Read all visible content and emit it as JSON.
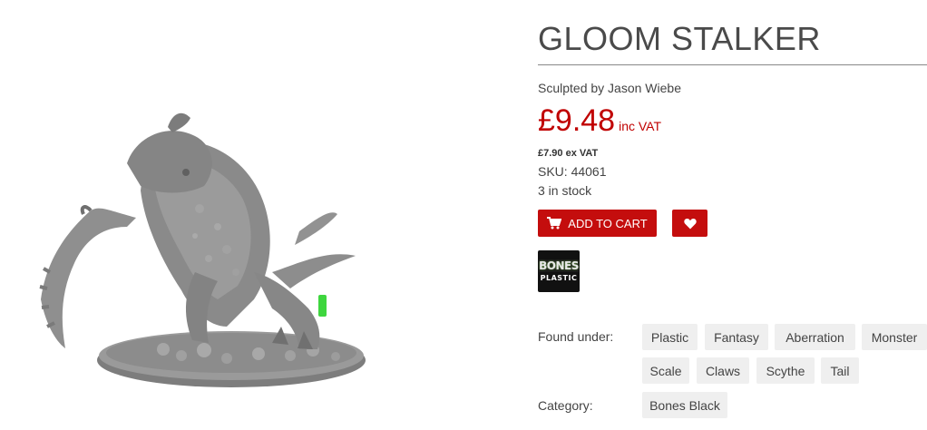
{
  "product": {
    "title": "GLOOM STALKER",
    "sculptor": "Sculpted by Jason Wiebe",
    "price_main": "£9.48",
    "price_suffix": "inc VAT",
    "price_ex_value": "£7.90",
    "price_ex_suffix": "ex VAT",
    "sku": "SKU: 44061",
    "stock": "3 in stock",
    "add_to_cart_label": "ADD TO CART",
    "brand_badge": {
      "top": "BONES",
      "bottom": "PLASTIC"
    }
  },
  "meta": {
    "found_under_label": "Found under:",
    "tags": [
      "Plastic",
      "Fantasy",
      "Aberration",
      "Monster",
      "Scale",
      "Claws",
      "Scythe",
      "Tail"
    ],
    "category_label": "Category:",
    "category": "Bones Black"
  },
  "icons": {
    "cart": "shopping-cart-icon",
    "wishlist": "heart-icon"
  },
  "colors": {
    "accent": "#c40d0d",
    "price": "#c00000",
    "tag_bg": "#efefef",
    "text": "#444444"
  }
}
